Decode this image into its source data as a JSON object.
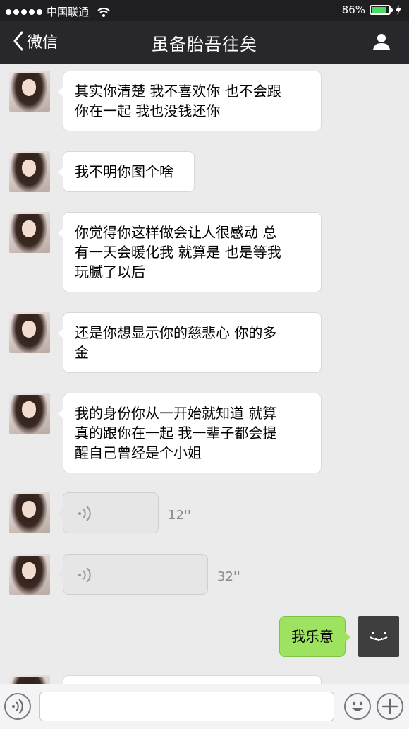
{
  "status_bar": {
    "carrier": "中国联通",
    "battery": "86%",
    "battery_level": 0.86,
    "signal_bars": 5
  },
  "nav": {
    "back_label": "微信",
    "title": "虽备胎吾往矣"
  },
  "messages": [
    {
      "from": "other",
      "type": "text",
      "lines": [
        "其实你清楚 我不喜欢你 也不会跟",
        "你在一起 我也没钱还你"
      ]
    },
    {
      "from": "other",
      "type": "text",
      "lines": [
        "我不明你图个啥"
      ]
    },
    {
      "from": "other",
      "type": "text",
      "lines": [
        "你觉得你这样做会让人很感动 总",
        "有一天会暖化我 就算是 也是等我",
        "玩腻了以后"
      ]
    },
    {
      "from": "other",
      "type": "text",
      "lines": [
        "还是你想显示你的慈悲心 你的多",
        "金"
      ]
    },
    {
      "from": "other",
      "type": "text",
      "lines": [
        "我的身份你从一开始就知道 就算",
        "真的跟你在一起 我一辈子都会提",
        "醒自己曾经是个小姐"
      ]
    },
    {
      "from": "other",
      "type": "voice",
      "duration": "12''"
    },
    {
      "from": "other",
      "type": "voice",
      "duration": "32''"
    },
    {
      "from": "me",
      "type": "text",
      "lines": [
        "我乐意"
      ]
    }
  ],
  "colors": {
    "my_bubble": "#9de35f",
    "nav_bg": "#28282c",
    "chat_bg": "#ebebeb"
  },
  "icons": [
    "back-chevron-icon",
    "profile-icon",
    "voice-wave-icon",
    "voice-input-icon",
    "emoji-icon",
    "plus-icon"
  ]
}
